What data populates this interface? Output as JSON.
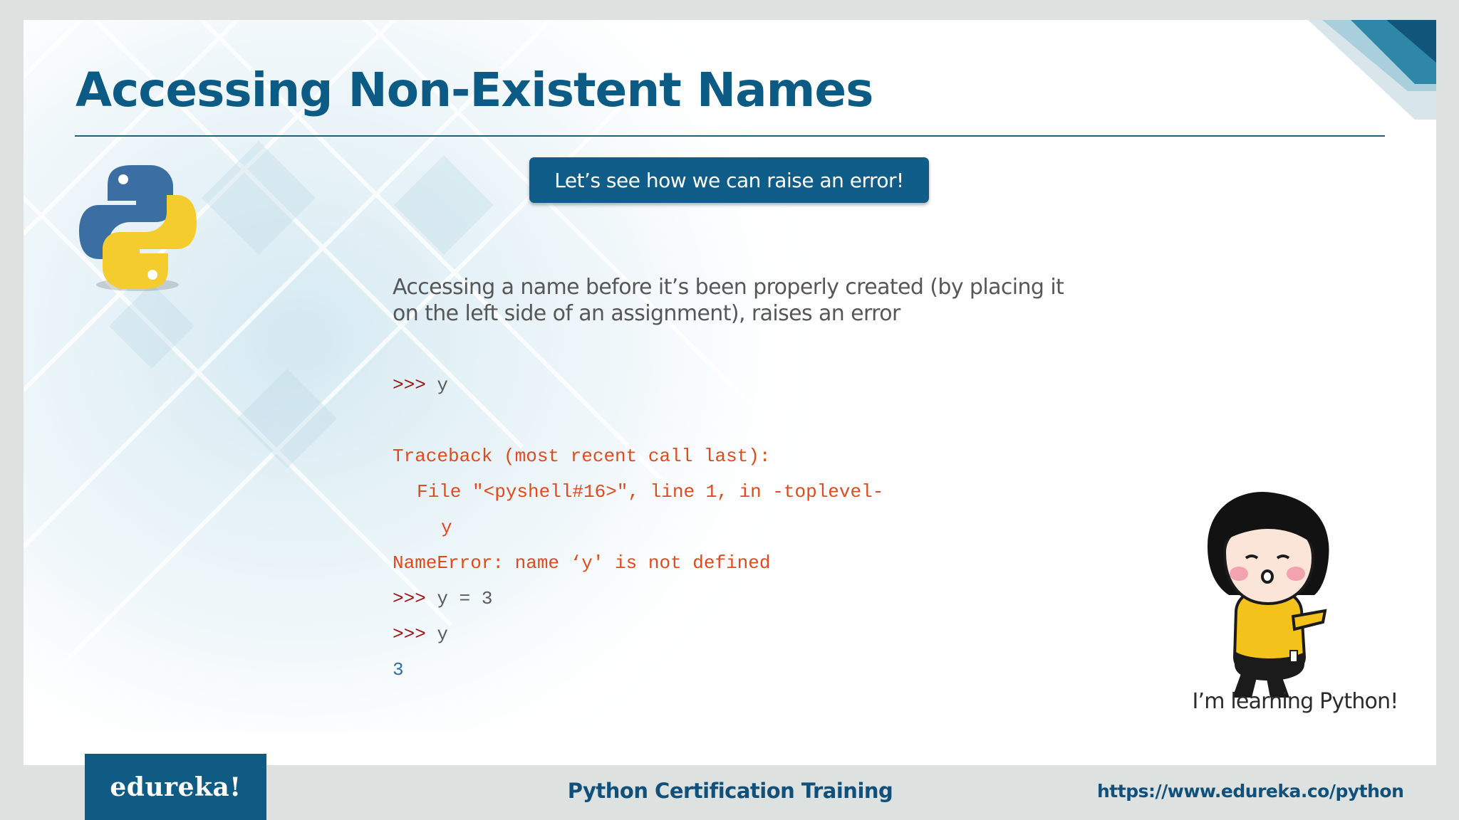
{
  "slide": {
    "title": "Accessing Non-Existent Names",
    "callout_button": "Let’s see how we can raise an error!",
    "description": "Accessing a name before it’s been properly created (by placing it on the left side of an assignment), raises an error",
    "code": {
      "line1_prompt": ">>>",
      "line1_text": "y",
      "traceback_header": "Traceback (most recent call last):",
      "traceback_file": "File \"<pyshell#16>\", line 1, in -toplevel-",
      "traceback_source": "y",
      "error_message": "NameError: name ‘y' is not defined",
      "line2_prompt": ">>>",
      "line2_text": "y = 3",
      "line3_prompt": ">>>",
      "line3_text": "y",
      "output": "3"
    },
    "mascot_caption": "I’m learning Python!"
  },
  "footer": {
    "logo_text": "edureka!",
    "course_title": "Python Certification Training",
    "url": "https://www.edureka.co/python"
  },
  "colors": {
    "title": "#0c5b85",
    "accent_blue": "#0f5d88",
    "error_text": "#e04a1c",
    "prompt": "#9b1515",
    "output": "#2f6fb0"
  },
  "icons": [
    "python-logo-icon",
    "mascot-girl-illustration"
  ]
}
